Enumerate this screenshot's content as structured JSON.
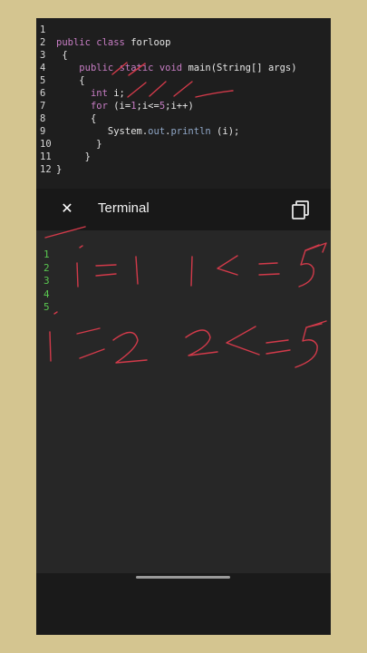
{
  "editor": {
    "lines": [
      {
        "n": "1",
        "indent": "",
        "segs": []
      },
      {
        "n": "2",
        "indent": "",
        "segs": [
          {
            "t": "public",
            "c": "kw"
          },
          {
            "t": " "
          },
          {
            "t": "class",
            "c": "kw"
          },
          {
            "t": " forloop"
          }
        ]
      },
      {
        "n": "3",
        "indent": " ",
        "segs": [
          {
            "t": "{"
          }
        ]
      },
      {
        "n": "4",
        "indent": "    ",
        "segs": [
          {
            "t": "public",
            "c": "kw"
          },
          {
            "t": " "
          },
          {
            "t": "static",
            "c": "kw"
          },
          {
            "t": " "
          },
          {
            "t": "void",
            "c": "kw"
          },
          {
            "t": " main(String[] args)"
          }
        ]
      },
      {
        "n": "5",
        "indent": "    ",
        "segs": [
          {
            "t": "{"
          }
        ]
      },
      {
        "n": "6",
        "indent": "      ",
        "segs": [
          {
            "t": "int",
            "c": "kw"
          },
          {
            "t": " i;"
          }
        ]
      },
      {
        "n": "7",
        "indent": "      ",
        "segs": [
          {
            "t": "for",
            "c": "kw"
          },
          {
            "t": " (i="
          },
          {
            "t": "1",
            "c": "num"
          },
          {
            "t": ";i<="
          },
          {
            "t": "5",
            "c": "num"
          },
          {
            "t": ";i++)"
          }
        ]
      },
      {
        "n": "8",
        "indent": "      ",
        "segs": [
          {
            "t": "{"
          }
        ]
      },
      {
        "n": "9",
        "indent": "         ",
        "segs": [
          {
            "t": "System."
          },
          {
            "t": "out",
            "c": "fld"
          },
          {
            "t": "."
          },
          {
            "t": "println",
            "c": "fld"
          },
          {
            "t": " (i);"
          }
        ]
      },
      {
        "n": "10",
        "indent": "       ",
        "segs": [
          {
            "t": "}"
          }
        ]
      },
      {
        "n": "11",
        "indent": "     ",
        "segs": [
          {
            "t": "}"
          }
        ]
      },
      {
        "n": "12",
        "indent": "",
        "segs": [
          {
            "t": "}"
          }
        ]
      }
    ]
  },
  "terminal": {
    "close_icon": "close-icon",
    "close_glyph": "✕",
    "title": "Terminal",
    "copy_icon": "copy-icon",
    "output": [
      "1",
      "2",
      "3",
      "4",
      "5"
    ]
  },
  "annotations": {
    "color": "#d23a4a",
    "note": "handwritten red ink strokes"
  },
  "colors": {
    "background": "#d4c590",
    "keyword": "#c77dc4",
    "field": "#8fa6c6",
    "output": "#59c64f"
  }
}
